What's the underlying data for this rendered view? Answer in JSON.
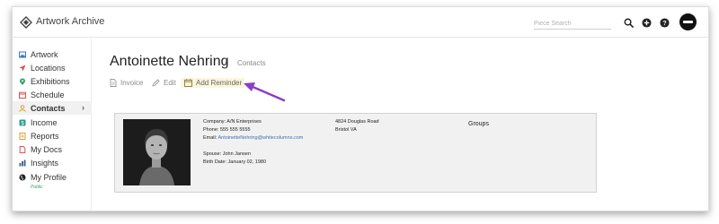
{
  "app": {
    "title": "Artwork Archive"
  },
  "search": {
    "placeholder": "Piece Search"
  },
  "sidebar": {
    "items": [
      {
        "label": "Artwork",
        "icon": "image-icon",
        "color": "#3a78c9"
      },
      {
        "label": "Locations",
        "icon": "location-arrow-icon",
        "color": "#d9534f"
      },
      {
        "label": "Exhibitions",
        "icon": "map-pin-icon",
        "color": "#3aa36a"
      },
      {
        "label": "Schedule",
        "icon": "calendar-icon",
        "color": "#d9534f"
      },
      {
        "label": "Contacts",
        "icon": "person-icon",
        "color": "#e0a030",
        "active": true
      },
      {
        "label": "Income",
        "icon": "income-icon",
        "color": "#2a9a9a"
      },
      {
        "label": "Reports",
        "icon": "reports-icon",
        "color": "#e0a030"
      },
      {
        "label": "My Docs",
        "icon": "docs-icon",
        "color": "#d9534f"
      },
      {
        "label": "Insights",
        "icon": "insights-icon",
        "color": "#3a5a9a"
      },
      {
        "label": "My Profile",
        "icon": "globe-icon",
        "color": "#222222"
      }
    ],
    "profile_status": "Public"
  },
  "page": {
    "title": "Antoinette Nehring",
    "breadcrumb_sep": "/",
    "breadcrumb": "Contacts"
  },
  "actions": {
    "invoice": "Invoice",
    "edit": "Edit",
    "add_reminder": "Add Reminder"
  },
  "contact": {
    "company": "Company: A/N Enterprises",
    "phone": "Phone: 555 555 5555",
    "email_label": "Email: ",
    "email": "AntoinetteNehring@whitecolumns.com",
    "spouse": "Spouse: John Jansen",
    "birth_date": "Birth Date: January 02, 1980",
    "address_line1": "4824 Douglas Road",
    "address_line2": "Bristol VA",
    "groups_label": "Groups"
  },
  "colors": {
    "accent_arrow": "#8a3fc0",
    "reminder_bg": "#fbf5dc",
    "link": "#3a6fb0"
  }
}
